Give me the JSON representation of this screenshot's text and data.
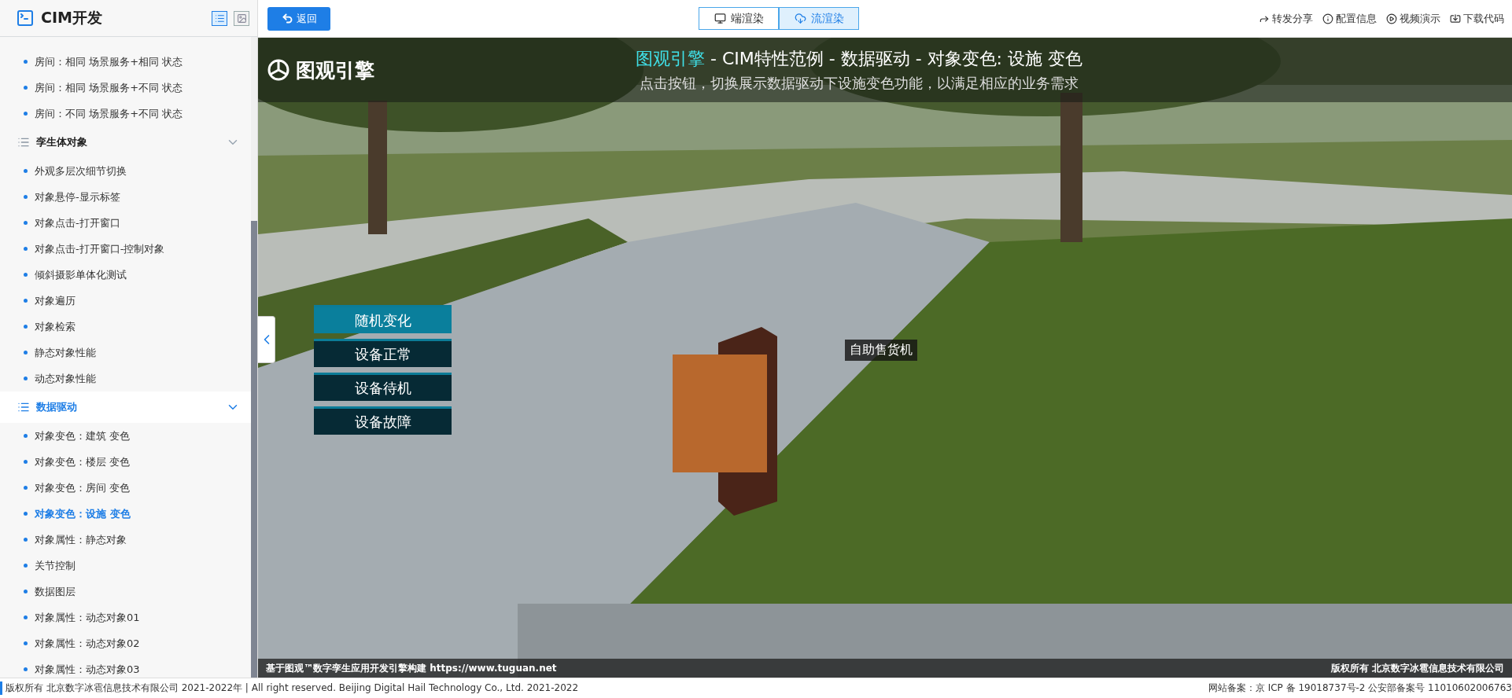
{
  "sidebar": {
    "title": "CIM开发",
    "view_modes": [
      {
        "kind": "list",
        "selected": true
      },
      {
        "kind": "picture",
        "selected": false
      }
    ],
    "loose_items": [
      {
        "label": "房间：相同 场景服务+相同 状态",
        "selected": false
      },
      {
        "label": "房间：相同 场景服务+不同 状态",
        "selected": false
      },
      {
        "label": "房间：不同 场景服务+不同 状态",
        "selected": false
      }
    ],
    "groups": [
      {
        "label": "孪生体对象",
        "expanded": true,
        "selected": false,
        "items": [
          {
            "label": "外观多层次细节切换",
            "selected": false
          },
          {
            "label": "对象悬停-显示标签",
            "selected": false
          },
          {
            "label": "对象点击-打开窗口",
            "selected": false
          },
          {
            "label": "对象点击-打开窗口-控制对象",
            "selected": false
          },
          {
            "label": "倾斜摄影单体化测试",
            "selected": false
          },
          {
            "label": "对象遍历",
            "selected": false
          },
          {
            "label": "对象检索",
            "selected": false
          },
          {
            "label": "静态对象性能",
            "selected": false
          },
          {
            "label": "动态对象性能",
            "selected": false
          }
        ]
      },
      {
        "label": "数据驱动",
        "expanded": true,
        "selected": true,
        "items": [
          {
            "label": "对象变色：建筑 变色",
            "selected": false
          },
          {
            "label": "对象变色：楼层 变色",
            "selected": false
          },
          {
            "label": "对象变色：房间 变色",
            "selected": false
          },
          {
            "label": "对象变色：设施 变色",
            "selected": true
          },
          {
            "label": "对象属性：静态对象",
            "selected": false
          },
          {
            "label": "关节控制",
            "selected": false
          },
          {
            "label": "数据图层",
            "selected": false
          },
          {
            "label": "对象属性：动态对象01",
            "selected": false
          },
          {
            "label": "对象属性：动态对象02",
            "selected": false
          },
          {
            "label": "对象属性：动态对象03",
            "selected": false
          }
        ]
      }
    ]
  },
  "topbar": {
    "back_button": "返回",
    "render_modes": [
      {
        "label": "端渲染",
        "kind": "desktop",
        "selected": false
      },
      {
        "label": "流渲染",
        "kind": "cloud",
        "selected": true
      }
    ],
    "links": [
      {
        "label": "转发分享",
        "kind": "share"
      },
      {
        "label": "配置信息",
        "kind": "info"
      },
      {
        "label": "视频演示",
        "kind": "play"
      },
      {
        "label": "下载代码",
        "kind": "download"
      }
    ]
  },
  "viewport": {
    "logo": "图观引擎",
    "title": {
      "highlight": "图观引擎",
      "rest": " - CIM特性范例 - 数据驱动 - 对象变色: 设施 变色"
    },
    "subtitle": "点击按钮，切换展示数据驱动下设施变色功能，以满足相应的业务需求",
    "controls": [
      {
        "label": "随机变化",
        "selected": true
      },
      {
        "label": "设备正常",
        "selected": false
      },
      {
        "label": "设备待机",
        "selected": false
      },
      {
        "label": "设备故障",
        "selected": false
      }
    ],
    "object_label": "自助售货机",
    "caption_left": "基于图观™数字孪生应用开发引擎构建 https://www.tuguan.net",
    "caption_right": "版权所有 北京数字冰雹信息技术有限公司"
  },
  "footer": {
    "left": "版权所有 北京数字冰雹信息技术有限公司 2021-2022年 | All right reserved. Beijing Digital Hail Technology Co., Ltd. 2021-2022",
    "right": "网站备案：京 ICP 备 19018737号-2 公安部备案号 11010602006763"
  }
}
